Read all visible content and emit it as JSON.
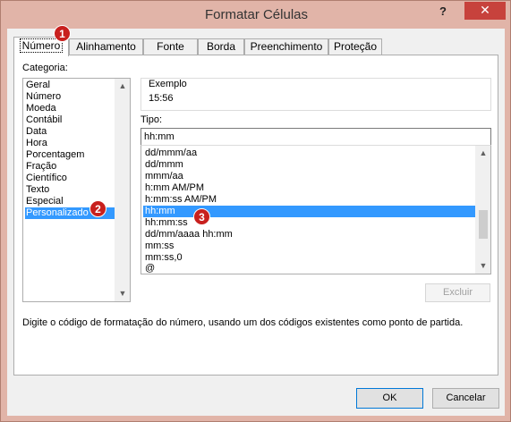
{
  "window": {
    "title": "Formatar Células",
    "help_label": "?",
    "close_label": "✕"
  },
  "tabs": [
    {
      "label": "Número"
    },
    {
      "label": "Alinhamento"
    },
    {
      "label": "Fonte"
    },
    {
      "label": "Borda"
    },
    {
      "label": "Preenchimento"
    },
    {
      "label": "Proteção"
    }
  ],
  "category": {
    "label": "Categoria:",
    "items": [
      "Geral",
      "Número",
      "Moeda",
      "Contábil",
      "Data",
      "Hora",
      "Porcentagem",
      "Fração",
      "Científico",
      "Texto",
      "Especial",
      "Personalizado"
    ],
    "selected": "Personalizado"
  },
  "example": {
    "label": "Exemplo",
    "value": "15:56"
  },
  "type": {
    "label": "Tipo:",
    "value": "hh:mm",
    "items": [
      "dd/mmm/aa",
      "dd/mmm",
      "mmm/aa",
      "h:mm AM/PM",
      "h:mm:ss AM/PM",
      "hh:mm",
      "hh:mm:ss",
      "dd/mm/aaaa hh:mm",
      "mm:ss",
      "mm:ss,0",
      "@"
    ],
    "selected": "hh:mm"
  },
  "buttons": {
    "delete": "Excluir",
    "ok": "OK",
    "cancel": "Cancelar"
  },
  "description": "Digite o código de formatação do número, usando um dos códigos existentes como ponto de partida.",
  "badges": [
    "1",
    "2",
    "3"
  ],
  "colors": {
    "selection": "#3399ff",
    "badge": "#c8201e",
    "close": "#c7423c"
  }
}
